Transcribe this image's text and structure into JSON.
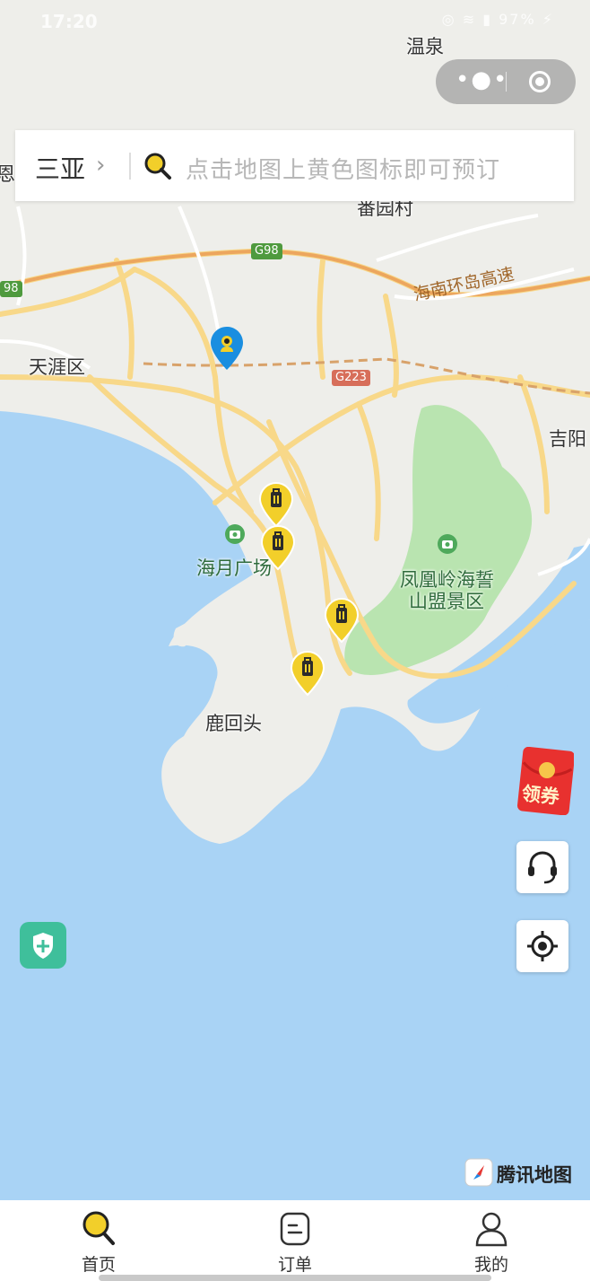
{
  "status_bar": {
    "time": "17:20",
    "battery": "97%"
  },
  "search_bar": {
    "city": "三亚",
    "placeholder": "点击地图上黄色图标即可预订"
  },
  "map_labels": {
    "wenquan": "温泉",
    "fanyuancun": "番园村",
    "tianya": "天涯区",
    "highway_ring": "海南环岛高速",
    "g98": "G98",
    "g98_edge": "98",
    "g223": "G223",
    "jiyang": "吉阳",
    "haiyue": "海月广场",
    "fenghuangling": "凤凰岭海誓",
    "fenghuangling_2": "山盟景区",
    "luhuitou": "鹿回头",
    "edge_left": "恩"
  },
  "red_packet_label": "领券",
  "map_provider": "腾讯地图",
  "tabs": [
    {
      "label": "首页",
      "icon": "search-icon",
      "active": true
    },
    {
      "label": "订单",
      "icon": "order-icon",
      "active": false
    },
    {
      "label": "我的",
      "icon": "user-icon",
      "active": false
    }
  ],
  "colors": {
    "accent_yellow": "#f2cf2a",
    "sea": "#a9d3f5",
    "park": "#b9e4b0",
    "road": "#f8d889",
    "safety_green": "#3fbf9b"
  }
}
